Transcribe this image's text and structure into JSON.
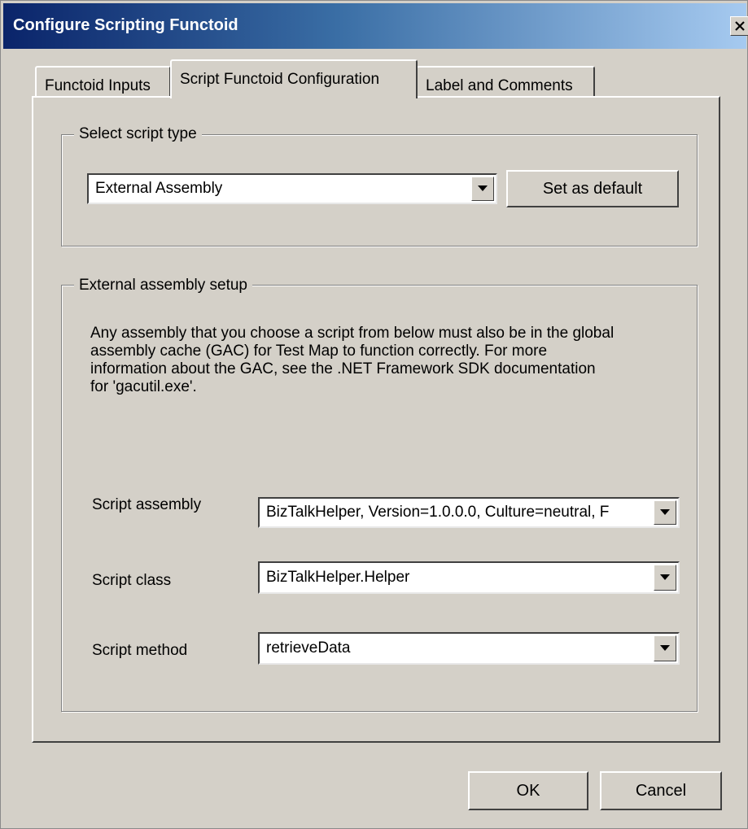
{
  "window": {
    "title": "Configure Scripting Functoid",
    "close_label": "×"
  },
  "tabs": [
    {
      "label": "Functoid Inputs"
    },
    {
      "label": "Script Functoid Configuration"
    },
    {
      "label": "Label and Comments"
    }
  ],
  "script_type_group": {
    "legend": "Select script type",
    "selected_type": "External Assembly",
    "set_default_label": "Set as default"
  },
  "assembly_group": {
    "legend": "External assembly setup",
    "description": [
      "Any assembly that you choose a script from below must also be in the global",
      "assembly cache (GAC) for Test Map to function correctly. For more",
      "information about the GAC, see the .NET Framework SDK documentation",
      "for 'gacutil.exe'."
    ],
    "fields": [
      {
        "label": "Script assembly",
        "value": "BizTalkHelper, Version=1.0.0.0, Culture=neutral, F"
      },
      {
        "label": "Script class",
        "value": "BizTalkHelper.Helper"
      },
      {
        "label": "Script method",
        "value": "retrieveData"
      }
    ]
  },
  "buttons": {
    "ok": "OK",
    "cancel": "Cancel"
  },
  "icons": {
    "dropdown": "chevron-down-icon",
    "close": "close-icon"
  }
}
